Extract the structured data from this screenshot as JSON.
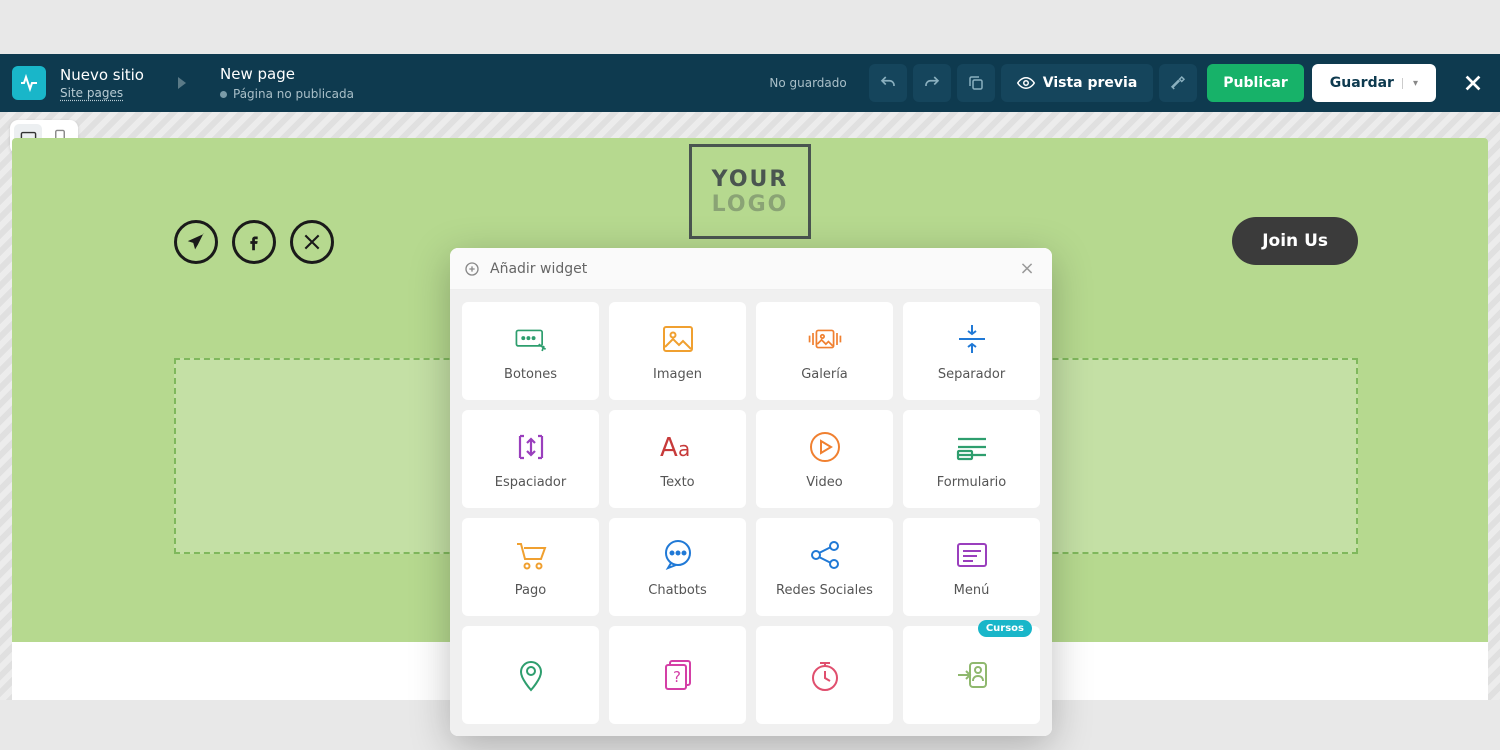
{
  "breadcrumb": {
    "site_title": "Nuevo sitio",
    "site_sub": "Site pages",
    "page_title": "New page",
    "page_status": "Página no publicada"
  },
  "topbar": {
    "save_status": "No guardado",
    "preview_label": "Vista previa",
    "publish_label": "Publicar",
    "save_label": "Guardar"
  },
  "preview": {
    "logo_line1": "YOUR",
    "logo_line2": "LOGO",
    "cta_label": "Join Us"
  },
  "modal": {
    "title": "Añadir widget",
    "widgets": [
      {
        "label": "Botones",
        "icon": "buttons",
        "color": "#2e9e6e"
      },
      {
        "label": "Imagen",
        "icon": "image",
        "color": "#f0a030"
      },
      {
        "label": "Galería",
        "icon": "gallery",
        "color": "#f08030"
      },
      {
        "label": "Separador",
        "icon": "separator",
        "color": "#2079d6"
      },
      {
        "label": "Espaciador",
        "icon": "spacer",
        "color": "#9a3fbd"
      },
      {
        "label": "Texto",
        "icon": "text",
        "color": "#c73a3a"
      },
      {
        "label": "Video",
        "icon": "video",
        "color": "#f08030"
      },
      {
        "label": "Formulario",
        "icon": "form",
        "color": "#2e9e6e"
      },
      {
        "label": "Pago",
        "icon": "cart",
        "color": "#f0a030"
      },
      {
        "label": "Chatbots",
        "icon": "chat",
        "color": "#2079d6"
      },
      {
        "label": "Redes Sociales",
        "icon": "share",
        "color": "#2079d6"
      },
      {
        "label": "Menú",
        "icon": "menu",
        "color": "#9a3fbd"
      },
      {
        "label": "",
        "icon": "location",
        "color": "#2e9e6e"
      },
      {
        "label": "",
        "icon": "quiz",
        "color": "#d43fa6"
      },
      {
        "label": "",
        "icon": "clock",
        "color": "#e04f6e"
      },
      {
        "label": "",
        "icon": "login",
        "color": "#8fb86e",
        "badge": "Cursos"
      }
    ]
  }
}
